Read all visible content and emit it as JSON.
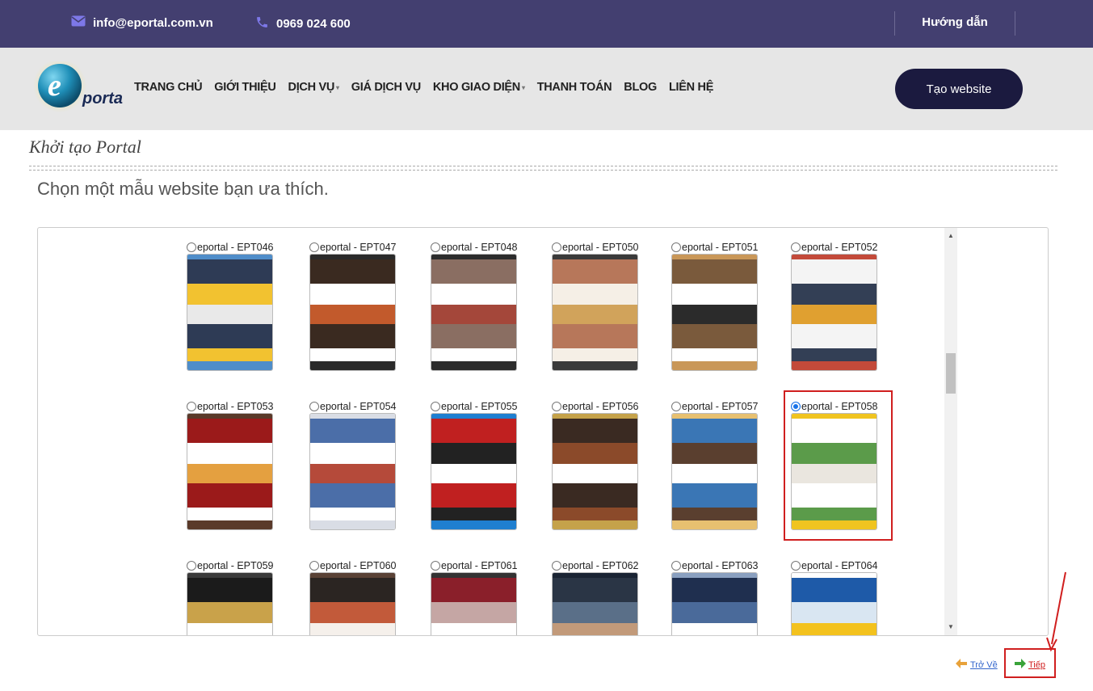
{
  "topbar": {
    "email": "info@eportal.com.vn",
    "phone": "0969 024 600",
    "help_label": "Hướng dẫn",
    "icons": {
      "email": "envelope-icon",
      "phone": "phone-icon"
    }
  },
  "header": {
    "logo_text": "portal",
    "nav": [
      {
        "label": "TRANG CHỦ",
        "dropdown": false
      },
      {
        "label": "GIỚI THIỆU",
        "dropdown": false
      },
      {
        "label": "DỊCH VỤ",
        "dropdown": true
      },
      {
        "label": "GIÁ DỊCH VỤ",
        "dropdown": false
      },
      {
        "label": "KHO GIAO DIỆN",
        "dropdown": true
      },
      {
        "label": "THANH TOÁN",
        "dropdown": false
      },
      {
        "label": "BLOG",
        "dropdown": false
      },
      {
        "label": "LIÊN HỆ",
        "dropdown": false
      }
    ],
    "cta_label": "Tạo website"
  },
  "main": {
    "title": "Khởi tạo Portal",
    "instruction": "Chọn một mẫu website bạn ưa thích."
  },
  "templates": {
    "selected": "eportal - EPT058",
    "items": [
      {
        "label": "eportal - EPT046",
        "palette": [
          "#2e3b55",
          "#f2c230",
          "#e9e9e9",
          "#4f8dc9"
        ]
      },
      {
        "label": "eportal - EPT047",
        "palette": [
          "#3a2a20",
          "#ffffff",
          "#c25a2c",
          "#2a2a2a"
        ]
      },
      {
        "label": "eportal - EPT048",
        "palette": [
          "#8a6e62",
          "#ffffff",
          "#a4473a",
          "#2c2c2c"
        ]
      },
      {
        "label": "eportal - EPT050",
        "palette": [
          "#b7775a",
          "#f5efe6",
          "#d1a35b",
          "#3a3a3a"
        ]
      },
      {
        "label": "eportal - EPT051",
        "palette": [
          "#7a5a3c",
          "#ffffff",
          "#2b2b2b",
          "#c99758"
        ]
      },
      {
        "label": "eportal - EPT052",
        "palette": [
          "#f4f4f4",
          "#333f55",
          "#e0a030",
          "#c34a3a"
        ]
      },
      {
        "label": "eportal - EPT053",
        "palette": [
          "#9b1a1a",
          "#ffffff",
          "#e4a040",
          "#5a3a2a"
        ]
      },
      {
        "label": "eportal - EPT054",
        "palette": [
          "#4b6ea8",
          "#ffffff",
          "#b54a3a",
          "#d9dde5"
        ]
      },
      {
        "label": "eportal - EPT055",
        "palette": [
          "#c02020",
          "#222222",
          "#ffffff",
          "#1f7fd0"
        ]
      },
      {
        "label": "eportal - EPT056",
        "palette": [
          "#3a2a22",
          "#8b4a2a",
          "#ffffff",
          "#c5a24a"
        ]
      },
      {
        "label": "eportal - EPT057",
        "palette": [
          "#3a76b5",
          "#5a3f2f",
          "#ffffff",
          "#e7c070"
        ]
      },
      {
        "label": "eportal - EPT058",
        "palette": [
          "#ffffff",
          "#5b9b4a",
          "#eae6df",
          "#f0c420"
        ]
      },
      {
        "label": "eportal - EPT059",
        "palette": [
          "#1b1b1b",
          "#c9a24a",
          "#ffffff",
          "#3a3a3a"
        ]
      },
      {
        "label": "eportal - EPT060",
        "palette": [
          "#2b2522",
          "#c25a3a",
          "#f5f0eb",
          "#5a4236"
        ]
      },
      {
        "label": "eportal - EPT061",
        "palette": [
          "#8a1f2a",
          "#c5a6a4",
          "#ffffff",
          "#333333"
        ]
      },
      {
        "label": "eportal - EPT062",
        "palette": [
          "#2a3545",
          "#5a6f88",
          "#c29a7a",
          "#1a2433"
        ]
      },
      {
        "label": "eportal - EPT063",
        "palette": [
          "#1f2f4f",
          "#4a6a9a",
          "#ffffff",
          "#8aa0c0"
        ]
      },
      {
        "label": "eportal - EPT064",
        "palette": [
          "#1e5aa8",
          "#d9e6f2",
          "#f3c21e",
          "#ffffff"
        ]
      }
    ]
  },
  "footer_nav": {
    "back_label": "Trở Về",
    "next_label": "Tiếp",
    "icons": {
      "back": "arrow-left-icon",
      "next": "arrow-right-icon"
    }
  },
  "colors": {
    "topbar_bg": "#433f70",
    "header_bg": "#e6e6e6",
    "cta_bg": "#1b1a3f",
    "highlight_red": "#d01f1f",
    "link_blue": "#3366cc"
  }
}
